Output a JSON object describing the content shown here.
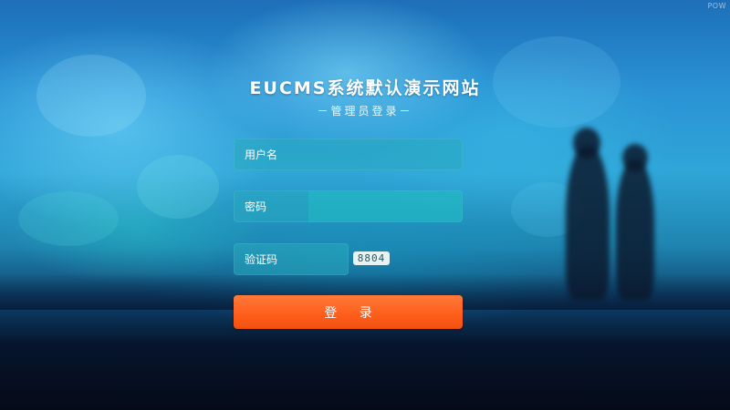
{
  "page": {
    "title": "EUCMS系统默认演示网站",
    "subtitle": "－管理员登录－",
    "powered": "POW"
  },
  "form": {
    "username_placeholder": "用户名",
    "password_placeholder": "密码",
    "captcha_placeholder": "验证码",
    "captcha_code": "8804",
    "login_label": "登 录"
  },
  "colors": {
    "login_button": "#ff5f1c",
    "field_background": "#28aabe",
    "title_text": "#ffffff"
  }
}
